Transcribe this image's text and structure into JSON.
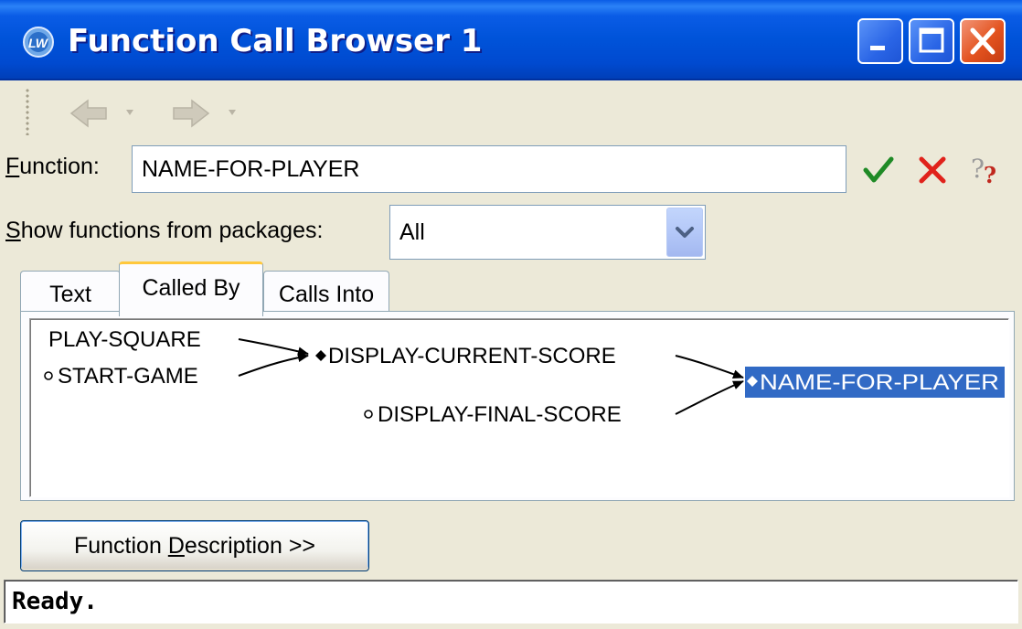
{
  "window": {
    "title": "Function Call Browser 1",
    "app_icon": "lispworks-icon"
  },
  "titlebar_buttons": {
    "minimize": "minimize-icon",
    "maximize": "maximize-icon",
    "close": "close-icon"
  },
  "toolbar": {
    "back": "back-arrow-icon",
    "forward": "forward-arrow-icon"
  },
  "function_row": {
    "label_prefix": "",
    "label_mnemonic": "F",
    "label_rest": "unction:",
    "value": "NAME-FOR-PLAYER",
    "apply_icon": "checkmark-icon",
    "cancel_icon": "red-x-icon",
    "help_icon": "help-question-icon"
  },
  "packages_row": {
    "label_mnemonic": "S",
    "label_rest": "how functions from packages:",
    "selected": "All"
  },
  "tabs": [
    {
      "label": "Text",
      "active": false
    },
    {
      "label": "Called By",
      "active": true
    },
    {
      "label": "Calls Into",
      "active": false
    }
  ],
  "graph": {
    "nodes": [
      {
        "label": "PLAY-SQUARE",
        "marker": "none"
      },
      {
        "label": "START-GAME",
        "marker": "open-circle"
      },
      {
        "label": "DISPLAY-CURRENT-SCORE",
        "marker": "filled-diamond"
      },
      {
        "label": "DISPLAY-FINAL-SCORE",
        "marker": "open-circle"
      },
      {
        "label": "NAME-FOR-PLAYER",
        "marker": "diamond",
        "selected": true
      }
    ],
    "selection_color": "#316ac5"
  },
  "description_button": {
    "before": "Function ",
    "mnemonic": "D",
    "after": "escription >>"
  },
  "status": "Ready."
}
